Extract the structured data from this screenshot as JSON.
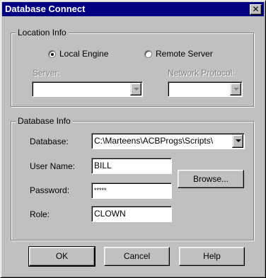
{
  "window": {
    "title": "Database Connect",
    "close_glyph": "✕"
  },
  "location_info": {
    "label": "Location Info",
    "local_engine_label": "Local Engine",
    "remote_server_label": "Remote Server",
    "selected": "local_engine",
    "server_label": "Server:",
    "server_value": "",
    "network_protocol_label": "Network Protocol:",
    "network_protocol_value": ""
  },
  "database_info": {
    "label": "Database Info",
    "database_label": "Database:",
    "database_value": "C:\\Marteens\\ACBProgs\\Scripts\\",
    "user_name_label": "User Name:",
    "user_name_value": "BILL",
    "password_label": "Password:",
    "password_value": "*****",
    "role_label": "Role:",
    "role_value": "CLOWN",
    "browse_label": "Browse..."
  },
  "buttons": {
    "ok": "OK",
    "cancel": "Cancel",
    "help": "Help"
  }
}
